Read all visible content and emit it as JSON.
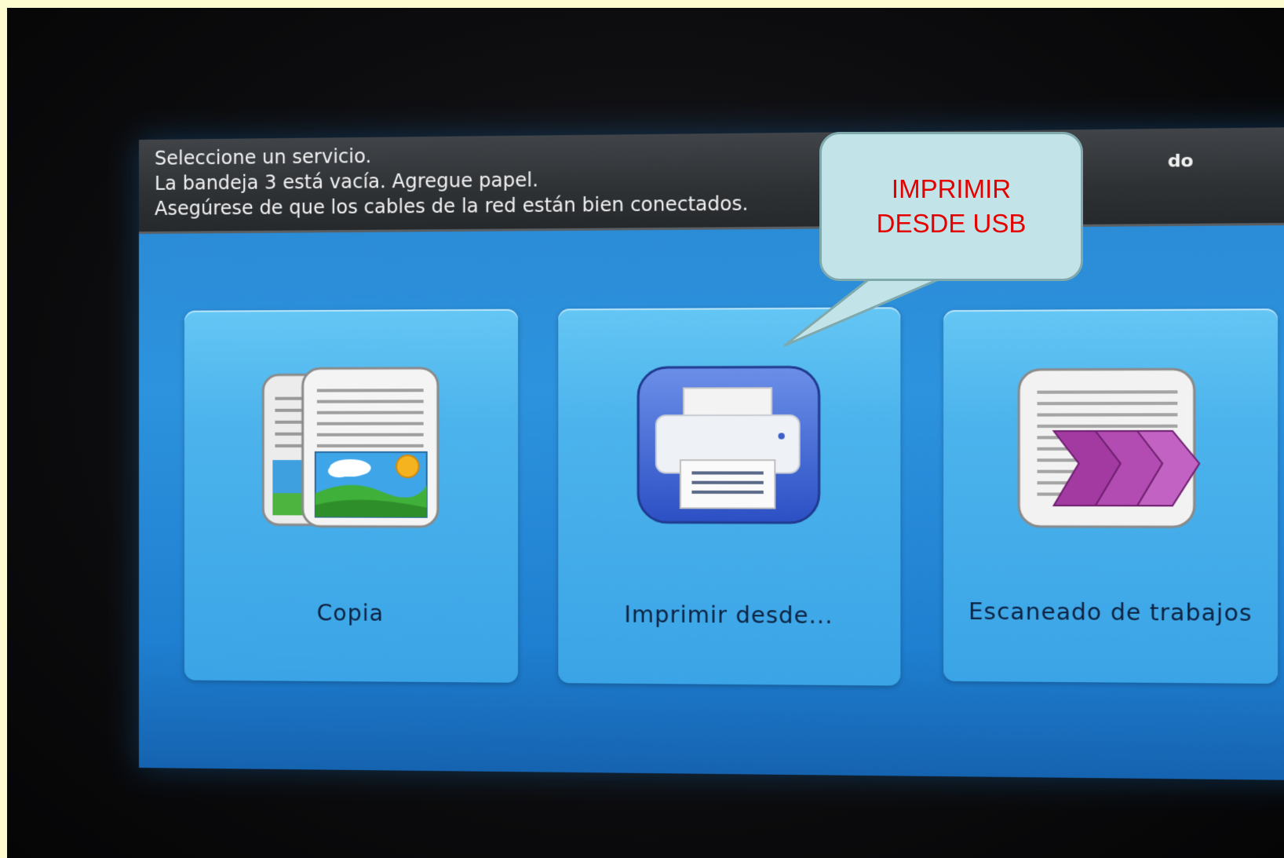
{
  "status_bar": {
    "lines": [
      "Seleccione un servicio.",
      "La bandeja 3 está vacía. Agregue papel.",
      "Asegúrese de que los cables de la red están bien conectados."
    ],
    "right_fragment": "do"
  },
  "services": [
    {
      "label": "Copia",
      "icon": "copy-icon"
    },
    {
      "label": "Imprimir desde...",
      "icon": "printer-icon"
    },
    {
      "label": "Escaneado de trabajos",
      "icon": "scan-icon"
    }
  ],
  "callout": {
    "text": "IMPRIMIR\nDESDE USB"
  },
  "colors": {
    "page_background": "#fdfbd0",
    "screen_blue": "#2d93de",
    "tile_blue": "#4cb3ec",
    "callout_fill": "#c2e4e8",
    "callout_text": "#e50000"
  }
}
